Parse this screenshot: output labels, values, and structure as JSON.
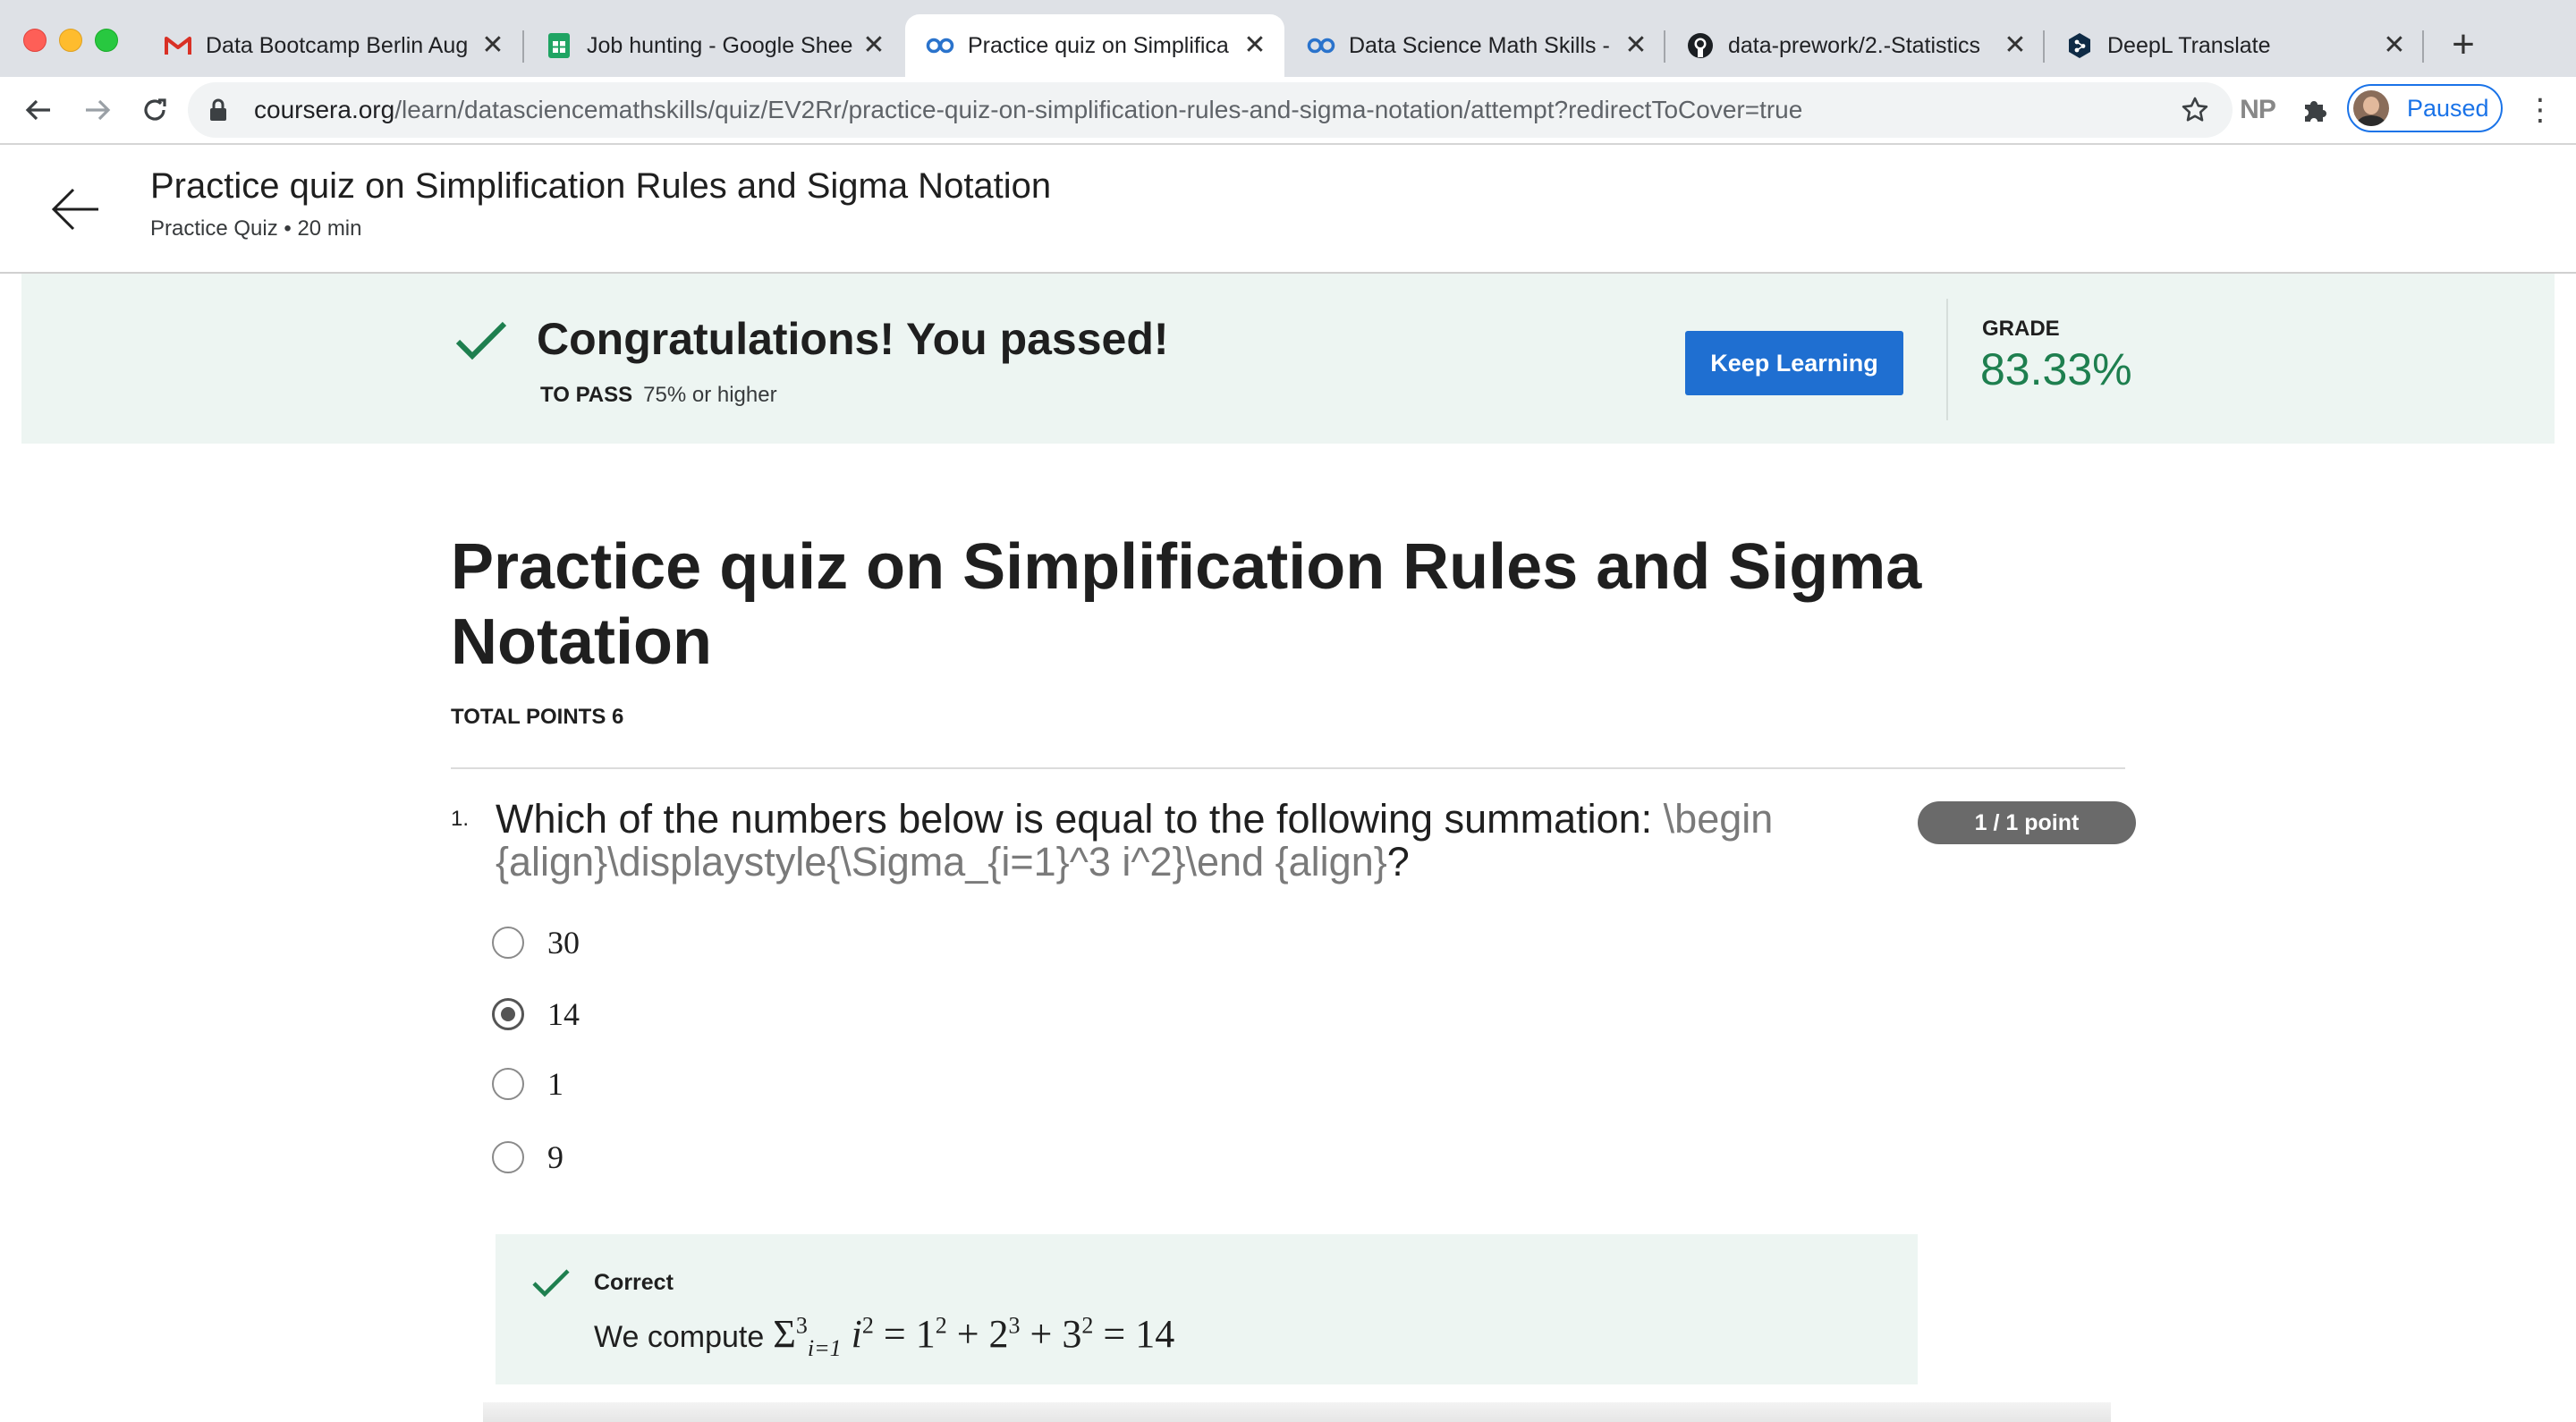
{
  "browser": {
    "tabs": [
      {
        "title": "Data Bootcamp Berlin Aug",
        "icon": "gmail-icon"
      },
      {
        "title": "Job hunting - Google Shee",
        "icon": "google-sheets-icon"
      },
      {
        "title": "Practice quiz on Simplifica",
        "icon": "coursera-icon",
        "active": true
      },
      {
        "title": "Data Science Math Skills -",
        "icon": "coursera-icon"
      },
      {
        "title": "data-prework/2.-Statistics",
        "icon": "github-icon"
      },
      {
        "title": "DeepL Translate",
        "icon": "deepl-icon"
      }
    ],
    "url_host": "coursera.org",
    "url_path": "/learn/datasciencemathskills/quiz/EV2Rr/practice-quiz-on-simplification-rules-and-sigma-notation/attempt?redirectToCover=true",
    "extension_np": "NP",
    "profile_label": "Paused",
    "accent_color": "#1a73e8"
  },
  "header": {
    "title": "Practice quiz on Simplification Rules and Sigma Notation",
    "subtitle": "Practice Quiz • 20 min"
  },
  "result": {
    "message": "Congratulations! You passed!",
    "to_pass_label": "TO PASS",
    "to_pass_value": "75% or higher",
    "keep_learning_label": "Keep Learning",
    "grade_label": "GRADE",
    "grade_value": "83.33%",
    "success_color": "#1e7f4f"
  },
  "quiz": {
    "title": "Practice quiz on Simplification Rules and Sigma Notation",
    "total_points": "TOTAL POINTS 6",
    "question": {
      "number": "1.",
      "text": "Which of the numbers below is equal to the following summation: ",
      "latex": "\\begin {align}\\displaystyle{\\Sigma_{i=1}^3 i^2}\\end {align}",
      "text_end": "?",
      "points": "1 / 1 point",
      "options": [
        {
          "label": "30",
          "selected": false
        },
        {
          "label": "14",
          "selected": true
        },
        {
          "label": "1",
          "selected": false
        },
        {
          "label": "9",
          "selected": false
        }
      ],
      "feedback": {
        "status": "Correct",
        "text": "We compute",
        "math": {
          "sigma": "Σ",
          "upper": "3",
          "lower": "i=1",
          "term": "i",
          "term_exp": "2",
          "equals": "=",
          "a": "1",
          "a_exp": "2",
          "b": "2",
          "b_exp": "3",
          "c": "3",
          "c_exp": "2",
          "plus": "+",
          "result": "14"
        }
      }
    }
  }
}
